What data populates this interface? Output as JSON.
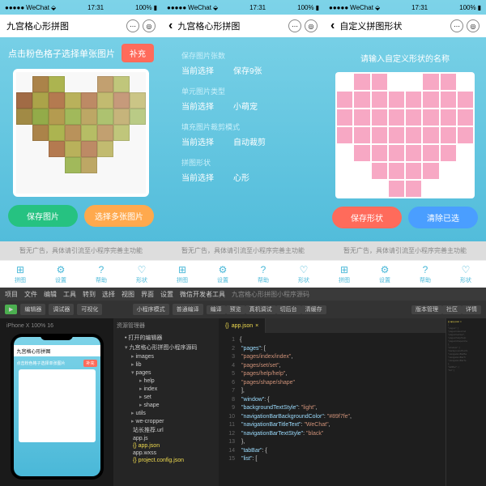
{
  "status": {
    "carrier": "WeChat",
    "signal": "●●●●●",
    "time": "17:31",
    "battery": "100%",
    "wifi": "⬙"
  },
  "phone1": {
    "title": "九宫格心形拼图",
    "hint": "点击粉色格子选择单张图片",
    "pill": "补充",
    "btn_save": "保存图片",
    "btn_choose": "选择多张图片",
    "ad": "暂无广告，具体请引流至小程序完善主功能"
  },
  "phone2": {
    "title": "九宫格心形拼图",
    "groups": [
      {
        "label": "保存图片张数",
        "k": "当前选择",
        "v": "保存9张"
      },
      {
        "label": "单元图片类型",
        "k": "当前选择",
        "v": "小萌宠"
      },
      {
        "label": "填充图片裁剪模式",
        "k": "当前选择",
        "v": "自动裁剪"
      },
      {
        "label": "拼图形状",
        "k": "当前选择",
        "v": "心形"
      }
    ],
    "ad": "暂无广告，具体请引流至小程序完善主功能"
  },
  "phone3": {
    "title": "自定义拼图形状",
    "hint": "请输入自定义形状的名称",
    "btn_save": "保存形状",
    "btn_clear": "清除已选",
    "ad": "暂无广告，具体请引流至小程序完善主功能"
  },
  "tabs": [
    {
      "icon": "⊞",
      "label": "拼图"
    },
    {
      "icon": "⚙",
      "label": "设置"
    },
    {
      "icon": "?",
      "label": "帮助"
    },
    {
      "icon": "♡",
      "label": "形状"
    }
  ],
  "ide": {
    "menubar": [
      "项目",
      "文件",
      "编辑",
      "工具",
      "转到",
      "选择",
      "视图",
      "界面",
      "设置",
      "微信开发者工具"
    ],
    "breadcrumb": "九宫格心形拼图小程序源码",
    "toolbar": {
      "mode": "小程序模式",
      "compile": "普通编译",
      "actions": [
        "编译",
        "预览",
        "真机调试",
        "切后台",
        "清缓存"
      ],
      "right": [
        "版本管理",
        "社区",
        "详情"
      ]
    },
    "sim_info": "iPhone X 100% 16",
    "explorer": {
      "title": "资源管理器",
      "subtitle": "• 打开的编辑器",
      "project": "九宫格心形拼图小程序源码",
      "folders": [
        "images",
        "lib",
        "pages"
      ],
      "pages": [
        "help",
        "index",
        "set",
        "shape"
      ],
      "more": [
        "utils",
        "we-cropper"
      ],
      "files": [
        "站长推荐.url",
        "app.js",
        "app.json",
        "app.wxss",
        "project.config.json"
      ]
    },
    "editor": {
      "tab": "app.json",
      "code": [
        "{",
        "  \"pages\": [",
        "    \"pages/index/index\",",
        "    \"pages/set/set\",",
        "    \"pages/help/help\",",
        "    \"pages/shape/shape\"",
        "  ],",
        "  \"window\": {",
        "    \"backgroundTextStyle\": \"light\",",
        "    \"navigationBarBackgroundColor\": \"#89f7fe\",",
        "    \"navigationBarTitleText\": \"WeChat\",",
        "    \"navigationBarTextStyle\": \"black\"",
        "  },",
        "  \"tabBar\": {",
        "    \"list\": ["
      ]
    }
  },
  "chart_data": null
}
